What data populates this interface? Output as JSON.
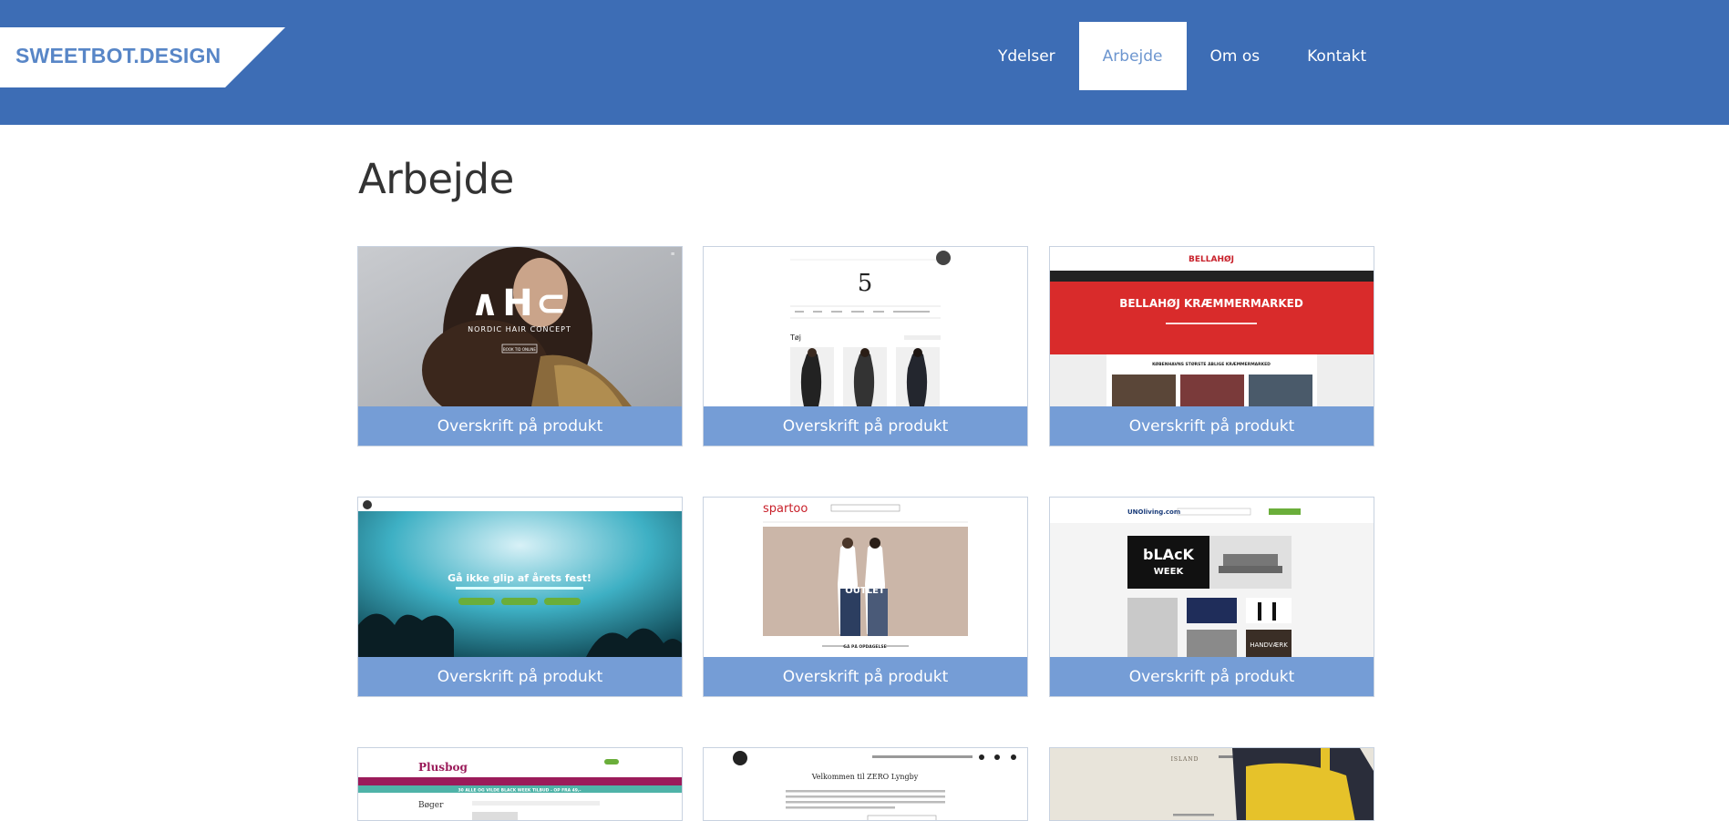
{
  "header": {
    "logo": "SWEETBOT.DESIGN",
    "nav": [
      {
        "label": "Ydelser",
        "active": false
      },
      {
        "label": "Arbejde",
        "active": true
      },
      {
        "label": "Om os",
        "active": false
      },
      {
        "label": "Kontakt",
        "active": false
      }
    ]
  },
  "main": {
    "title": "Arbejde",
    "cards": [
      {
        "caption": "Overskrift på produkt",
        "thumb": {
          "brand": "NORDIC HAIR CONCEPT",
          "button": "BOOK TID ONLINE"
        }
      },
      {
        "caption": "Overskrift på produkt",
        "thumb": {
          "heading": "Tøj"
        }
      },
      {
        "caption": "Overskrift på produkt",
        "thumb": {
          "brand": "BELLAHØJ",
          "headline": "BELLAHØJ KRÆMMERMARKED",
          "sub": "KØBENHAVNS STØRSTE ÅBLIGE KRÆMMERMARKED"
        }
      },
      {
        "caption": "Overskrift på produkt",
        "thumb": {
          "headline": "Gå ikke glip af årets fest!"
        }
      },
      {
        "caption": "Overskrift på produkt",
        "thumb": {
          "brand": "spartoo",
          "banner": "OUTLET",
          "section": "GÅ PÅ OPDAGELSE"
        }
      },
      {
        "caption": "Overskrift på produkt",
        "thumb": {
          "brand": "UNOliving.com",
          "banner_top": "bLAcK",
          "banner_bottom": "WEEK",
          "label": "HANDVÆRK"
        }
      },
      {
        "caption": "",
        "thumb": {
          "brand": "Plusbog",
          "strip": "30 ALLE OG VILDE BLACK WEEK TILBUD - OP FRA 49,-",
          "heading": "Bøger"
        }
      },
      {
        "caption": "",
        "thumb": {
          "headline": "Velkommen til ZERO Lyngby"
        }
      },
      {
        "caption": "",
        "thumb": {
          "brand": "ISLAND"
        }
      }
    ]
  },
  "colors": {
    "header_bg": "#3d6db5",
    "caption_bg": "#759dd6",
    "active_text": "#6d96cf"
  }
}
